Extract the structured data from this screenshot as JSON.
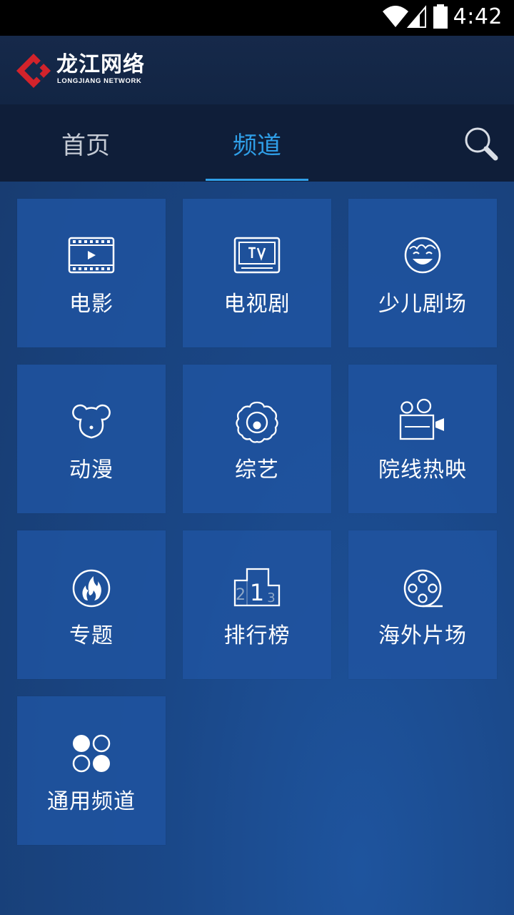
{
  "status_bar": {
    "time": "4:42"
  },
  "header": {
    "logo_title": "龙江网络",
    "logo_subtitle": "LONGJIANG NETWORK",
    "brand_color": "#d3232b"
  },
  "tabs": [
    {
      "label": "首页",
      "active": false
    },
    {
      "label": "频道",
      "active": true
    }
  ],
  "search": {
    "icon": "search-icon"
  },
  "accent_color": "#2f9fe8",
  "channels": [
    {
      "label": "电影",
      "icon": "film-icon"
    },
    {
      "label": "电视剧",
      "icon": "tv-icon"
    },
    {
      "label": "少儿剧场",
      "icon": "smiley-icon"
    },
    {
      "label": "动漫",
      "icon": "mouse-ears-icon"
    },
    {
      "label": "综艺",
      "icon": "flower-icon"
    },
    {
      "label": "院线热映",
      "icon": "movie-camera-icon"
    },
    {
      "label": "专题",
      "icon": "flame-icon"
    },
    {
      "label": "排行榜",
      "icon": "podium-icon"
    },
    {
      "label": "海外片场",
      "icon": "film-reel-icon"
    },
    {
      "label": "通用频道",
      "icon": "four-dots-icon"
    }
  ],
  "podium_numbers": [
    "2",
    "1",
    "3"
  ]
}
